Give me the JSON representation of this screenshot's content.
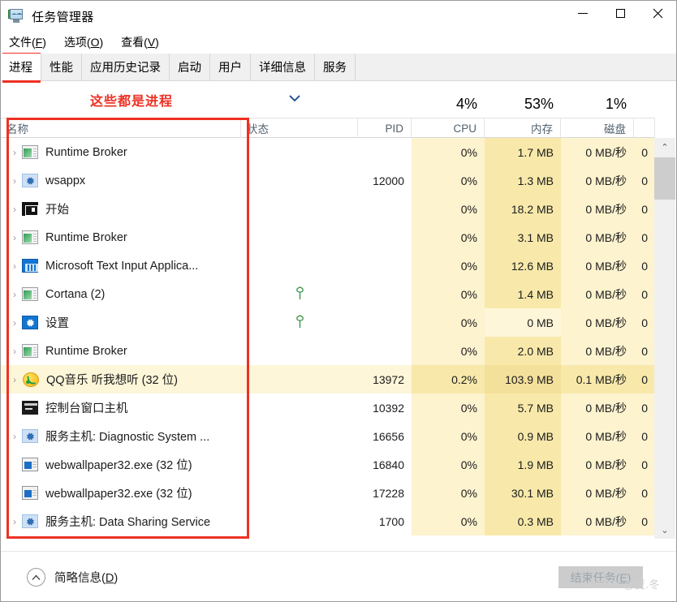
{
  "window": {
    "title": "任务管理器",
    "icon": "task-manager-icon",
    "minimize": "—",
    "maximize": "☐",
    "close": "✕"
  },
  "menu": [
    {
      "label": "文件(F)",
      "name": "menu-file"
    },
    {
      "label": "选项(O)",
      "name": "menu-options"
    },
    {
      "label": "查看(V)",
      "name": "menu-view"
    }
  ],
  "tabs": [
    {
      "label": "进程",
      "active": true
    },
    {
      "label": "性能",
      "active": false
    },
    {
      "label": "应用历史记录",
      "active": false
    },
    {
      "label": "启动",
      "active": false
    },
    {
      "label": "用户",
      "active": false
    },
    {
      "label": "详细信息",
      "active": false
    },
    {
      "label": "服务",
      "active": false
    }
  ],
  "annotation": {
    "text": "这些都是进程",
    "color": "#ee3124"
  },
  "table": {
    "sort_indicator": "⌄",
    "columns": [
      {
        "key": "name",
        "label": "名称",
        "pct": "",
        "align": "left"
      },
      {
        "key": "status",
        "label": "状态",
        "pct": "",
        "align": "left"
      },
      {
        "key": "pid",
        "label": "PID",
        "pct": "",
        "align": "right"
      },
      {
        "key": "cpu",
        "label": "CPU",
        "pct": "4%",
        "align": "right"
      },
      {
        "key": "memory",
        "label": "内存",
        "pct": "53%",
        "align": "right"
      },
      {
        "key": "disk",
        "label": "磁盘",
        "pct": "1%",
        "align": "right"
      },
      {
        "key": "network",
        "label": "",
        "pct": "",
        "align": "right"
      }
    ],
    "rows": [
      {
        "name": "Runtime Broker",
        "icon": "window-green-icon",
        "expandable": true,
        "status": "",
        "pid": "",
        "cpu": "0%",
        "memory": "1.7 MB",
        "disk": "0 MB/秒",
        "network": "0"
      },
      {
        "name": "wsappx",
        "icon": "gear-light-icon",
        "expandable": true,
        "status": "",
        "pid": "12000",
        "cpu": "0%",
        "memory": "1.3 MB",
        "disk": "0 MB/秒",
        "network": "0"
      },
      {
        "name": "开始",
        "icon": "start-icon",
        "expandable": true,
        "status": "",
        "pid": "",
        "cpu": "0%",
        "memory": "18.2 MB",
        "disk": "0 MB/秒",
        "network": "0"
      },
      {
        "name": "Runtime Broker",
        "icon": "window-green-icon",
        "expandable": true,
        "status": "",
        "pid": "",
        "cpu": "0%",
        "memory": "3.1 MB",
        "disk": "0 MB/秒",
        "network": "0"
      },
      {
        "name": "Microsoft Text Input Applica...",
        "icon": "keyboard-icon",
        "expandable": true,
        "status": "",
        "pid": "",
        "cpu": "0%",
        "memory": "12.6 MB",
        "disk": "0 MB/秒",
        "network": "0"
      },
      {
        "name": "Cortana (2)",
        "icon": "window-green-icon",
        "expandable": true,
        "status": "leaf-suspended-icon",
        "pid": "",
        "cpu": "0%",
        "memory": "1.4 MB",
        "disk": "0 MB/秒",
        "network": "0"
      },
      {
        "name": "设置",
        "icon": "gear-blue-icon",
        "expandable": true,
        "status": "leaf-suspended-icon",
        "pid": "",
        "cpu": "0%",
        "memory": "0 MB",
        "disk": "0 MB/秒",
        "network": "0",
        "highlight": "light"
      },
      {
        "name": "Runtime Broker",
        "icon": "window-green-icon",
        "expandable": true,
        "status": "",
        "pid": "",
        "cpu": "0%",
        "memory": "2.0 MB",
        "disk": "0 MB/秒",
        "network": "0"
      },
      {
        "name": "QQ音乐 听我想听 (32 位)",
        "icon": "qq-music-icon",
        "expandable": true,
        "status": "",
        "pid": "13972",
        "cpu": "0.2%",
        "memory": "103.9 MB",
        "disk": "0.1 MB/秒",
        "network": "0",
        "highlight": "selected"
      },
      {
        "name": "控制台窗口主机",
        "icon": "console-icon",
        "expandable": false,
        "status": "",
        "pid": "10392",
        "cpu": "0%",
        "memory": "5.7 MB",
        "disk": "0 MB/秒",
        "network": "0"
      },
      {
        "name": "服务主机: Diagnostic System ...",
        "icon": "gear-light-icon",
        "expandable": true,
        "status": "",
        "pid": "16656",
        "cpu": "0%",
        "memory": "0.9 MB",
        "disk": "0 MB/秒",
        "network": "0"
      },
      {
        "name": "webwallpaper32.exe (32 位)",
        "icon": "window-blue-icon",
        "expandable": false,
        "status": "",
        "pid": "16840",
        "cpu": "0%",
        "memory": "1.9 MB",
        "disk": "0 MB/秒",
        "network": "0"
      },
      {
        "name": "webwallpaper32.exe (32 位)",
        "icon": "window-blue-icon",
        "expandable": false,
        "status": "",
        "pid": "17228",
        "cpu": "0%",
        "memory": "30.1 MB",
        "disk": "0 MB/秒",
        "network": "0"
      },
      {
        "name": "服务主机: Data Sharing Service",
        "icon": "gear-light-icon",
        "expandable": true,
        "status": "",
        "pid": "1700",
        "cpu": "0%",
        "memory": "0.3 MB",
        "disk": "0 MB/秒",
        "network": "0"
      }
    ]
  },
  "scrollbars": {
    "v_up": "⌃",
    "v_down": "⌄",
    "h_left": "‹",
    "h_right": "›"
  },
  "footer": {
    "brief_label": "简略信息(D)",
    "brief_icon": "chevron-up-circle-icon",
    "end_task_label": "结束任务(E)",
    "end_task_enabled": false,
    "watermark": "CSDN @夏.冬"
  },
  "colors": {
    "accent_red": "#ee3124",
    "tint_cpu": "#fdf3cf",
    "tint_memory": "#f8e9ab",
    "tint_disk": "#fdf3cf",
    "tint_network": "#fdf3cf"
  }
}
